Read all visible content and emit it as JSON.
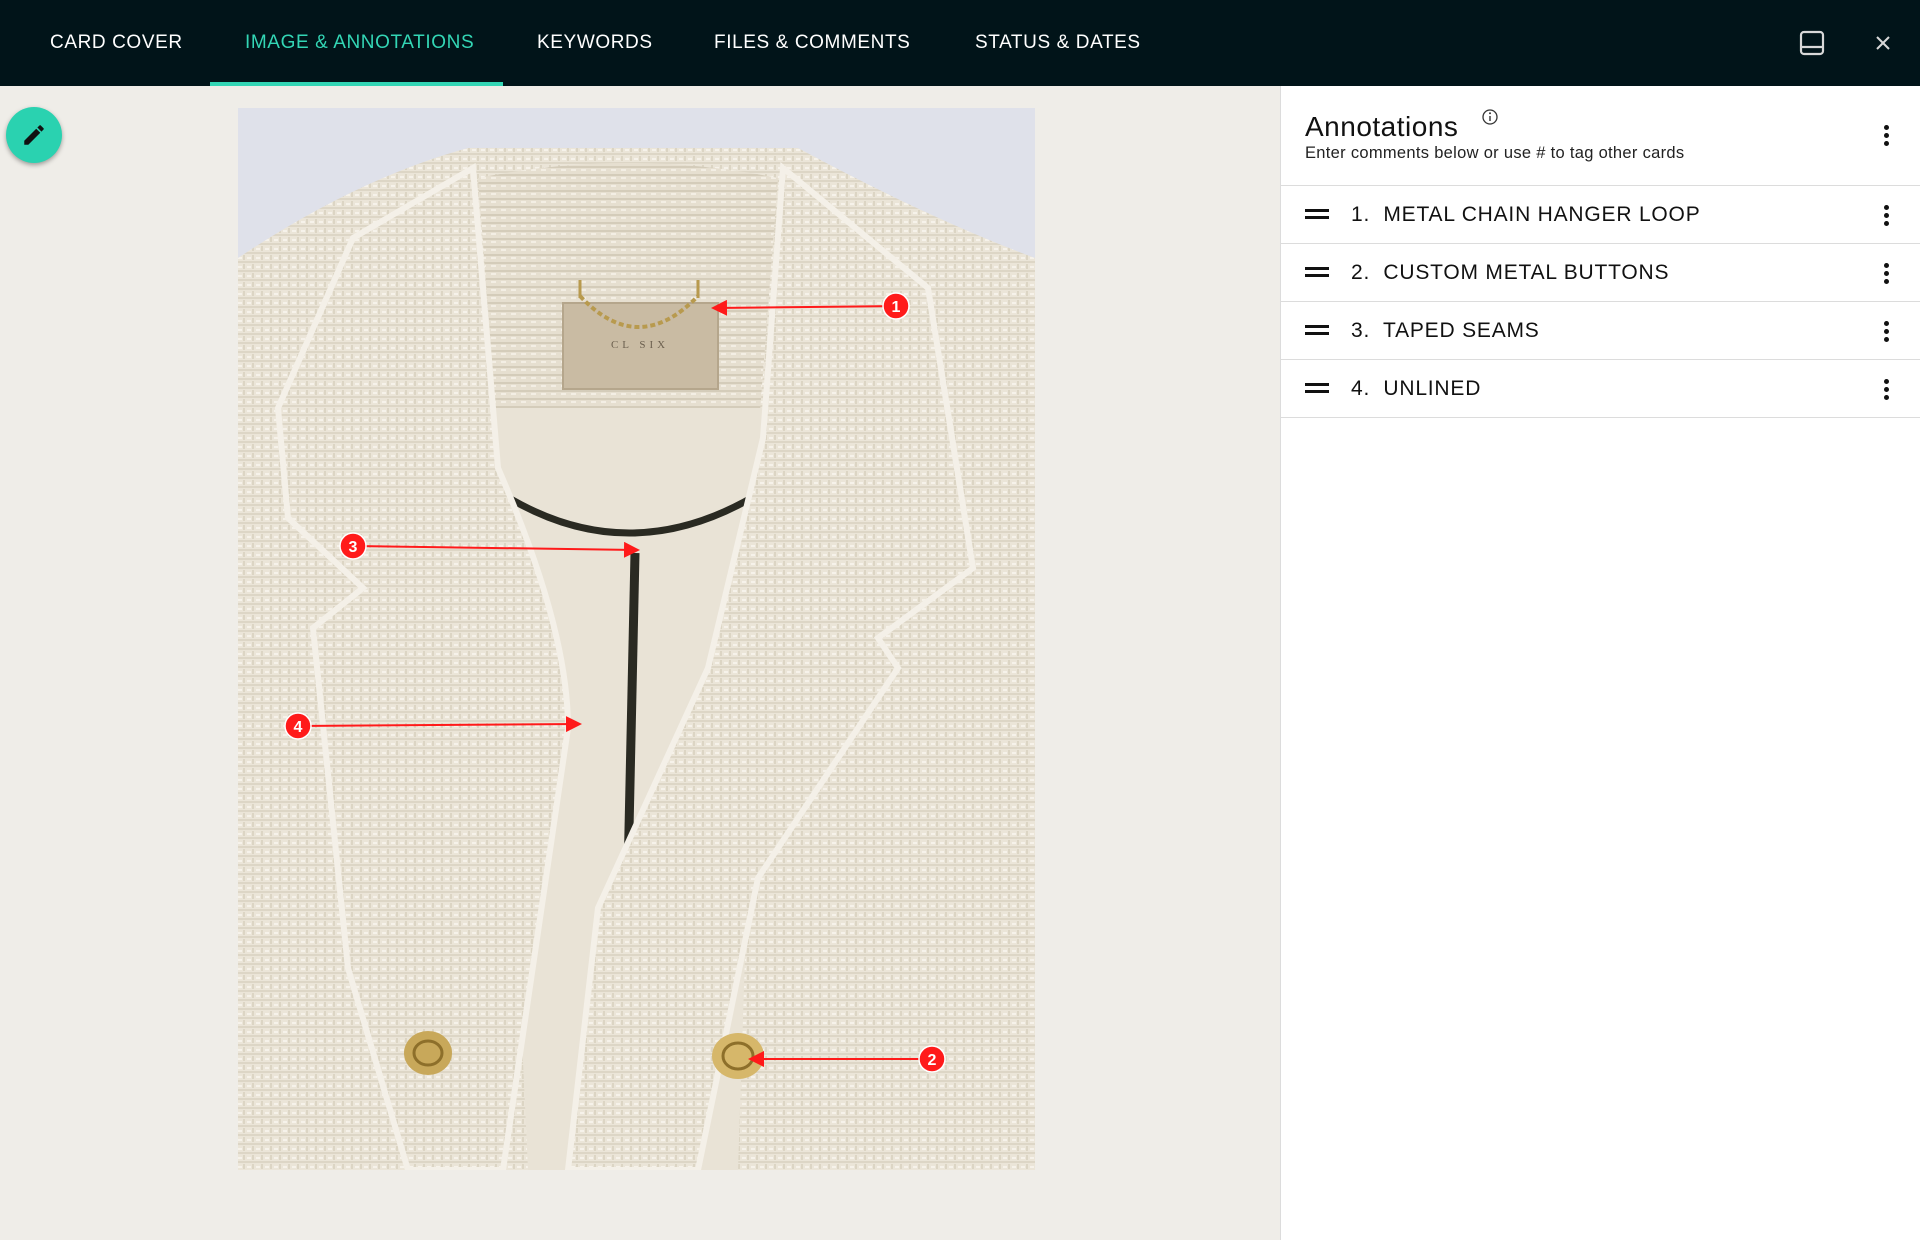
{
  "tabs": [
    {
      "label": "CARD COVER"
    },
    {
      "label": "IMAGE & ANNOTATIONS",
      "active": true
    },
    {
      "label": "KEYWORDS"
    },
    {
      "label": "FILES & COMMENTS"
    },
    {
      "label": "STATUS & DATES"
    }
  ],
  "topbar_icons": [
    "panel-toggle-icon",
    "close-icon"
  ],
  "colors": {
    "accent": "#33d6b5",
    "topbar": "#011419",
    "workspace": "#efede8",
    "marker": "#ff1a1a"
  },
  "photo": {
    "markers": [
      "1",
      "2",
      "3",
      "4"
    ],
    "label_letters": "CL   SIX"
  },
  "panel": {
    "title": "Annotations",
    "subtitle": "Enter comments below or use # to tag other cards",
    "items": [
      {
        "label": "1.  METAL CHAIN HANGER LOOP"
      },
      {
        "label": "2.  CUSTOM METAL BUTTONS"
      },
      {
        "label": "3.  TAPED SEAMS"
      },
      {
        "label": "4.  UNLINED"
      }
    ]
  }
}
